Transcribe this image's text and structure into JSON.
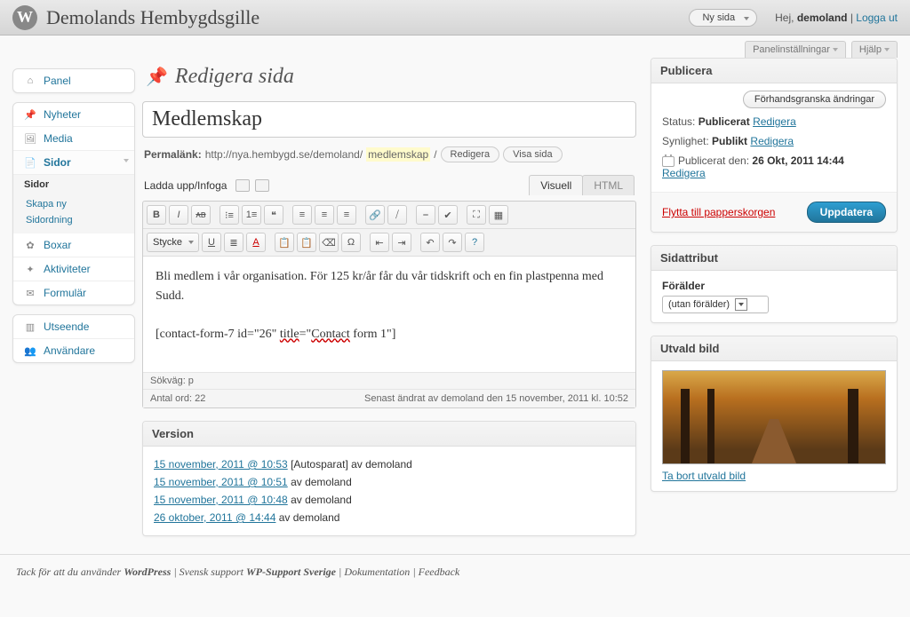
{
  "adminbar": {
    "site_title": "Demolands Hembygdsgille",
    "new_button": "Ny sida",
    "howdy_prefix": "Hej, ",
    "username": "demoland",
    "sep": " | ",
    "logout": "Logga ut"
  },
  "screen": {
    "options": "Panelinställningar",
    "help": "Hjälp"
  },
  "sidebar": {
    "panel": "Panel",
    "news": "Nyheter",
    "media": "Media",
    "pages": "Sidor",
    "pages_sub_head": "Sidor",
    "pages_new": "Skapa ny",
    "pages_order": "Sidordning",
    "boxes": "Boxar",
    "activities": "Aktiviteter",
    "forms": "Formulär",
    "appearance": "Utseende",
    "users": "Användare"
  },
  "heading": "Redigera sida",
  "title": "Medlemskap",
  "permalink": {
    "label": "Permalänk:",
    "base": "http://nya.hembygd.se/demoland/",
    "slug": "medlemskap",
    "suffix": "/",
    "edit": "Redigera",
    "view": "Visa sida"
  },
  "upload": {
    "label": "Ladda upp/Infoga",
    "tab_visual": "Visuell",
    "tab_html": "HTML"
  },
  "toolbar": {
    "format": "Stycke"
  },
  "editor": {
    "line1": "Bli medlem i vår organisation. För 125 kr/år får du vår tidskrift och en fin plastpenna med Sudd.",
    "line2_a": "[contact-form-7 id=\"26\" ",
    "line2_title": "title",
    "line2_b": "=\"",
    "line2_contact": "Contact",
    "line2_c": " form 1\"]",
    "path": "Sökväg: p",
    "wordcount_label": "Antal ord: ",
    "wordcount": "22",
    "lastedit": "Senast ändrat av demoland den 15 november, 2011 kl. 10:52"
  },
  "revisions": {
    "heading": "Version",
    "items": [
      {
        "date": "15 november, 2011 @ 10:53",
        "suffix": " [Autosparat] av demoland"
      },
      {
        "date": "15 november, 2011 @ 10:51",
        "suffix": " av demoland"
      },
      {
        "date": "15 november, 2011 @ 10:48",
        "suffix": " av demoland"
      },
      {
        "date": "26 oktober, 2011 @ 14:44",
        "suffix": " av demoland"
      }
    ]
  },
  "publish": {
    "heading": "Publicera",
    "preview": "Förhandsgranska ändringar",
    "status_label": "Status: ",
    "status_value": "Publicerat",
    "status_edit": "Redigera",
    "visibility_label": "Synlighet: ",
    "visibility_value": "Publikt",
    "visibility_edit": "Redigera",
    "published_label": "Publicerat den: ",
    "published_value": "26 Okt, 2011 14:44",
    "published_edit": "Redigera",
    "trash": "Flytta till papperskorgen",
    "update": "Uppdatera"
  },
  "attributes": {
    "heading": "Sidattribut",
    "parent_label": "Förälder",
    "parent_value": "(utan förälder)"
  },
  "featured": {
    "heading": "Utvald bild",
    "remove": "Ta bort utvald bild"
  },
  "footer": {
    "thanks_a": "Tack för att du använder ",
    "wp": "WordPress",
    "sep": " | ",
    "sv_a": "Svensk support ",
    "sv_b": "WP-Support Sverige",
    "docs": "Dokumentation",
    "feedback": "Feedback"
  }
}
